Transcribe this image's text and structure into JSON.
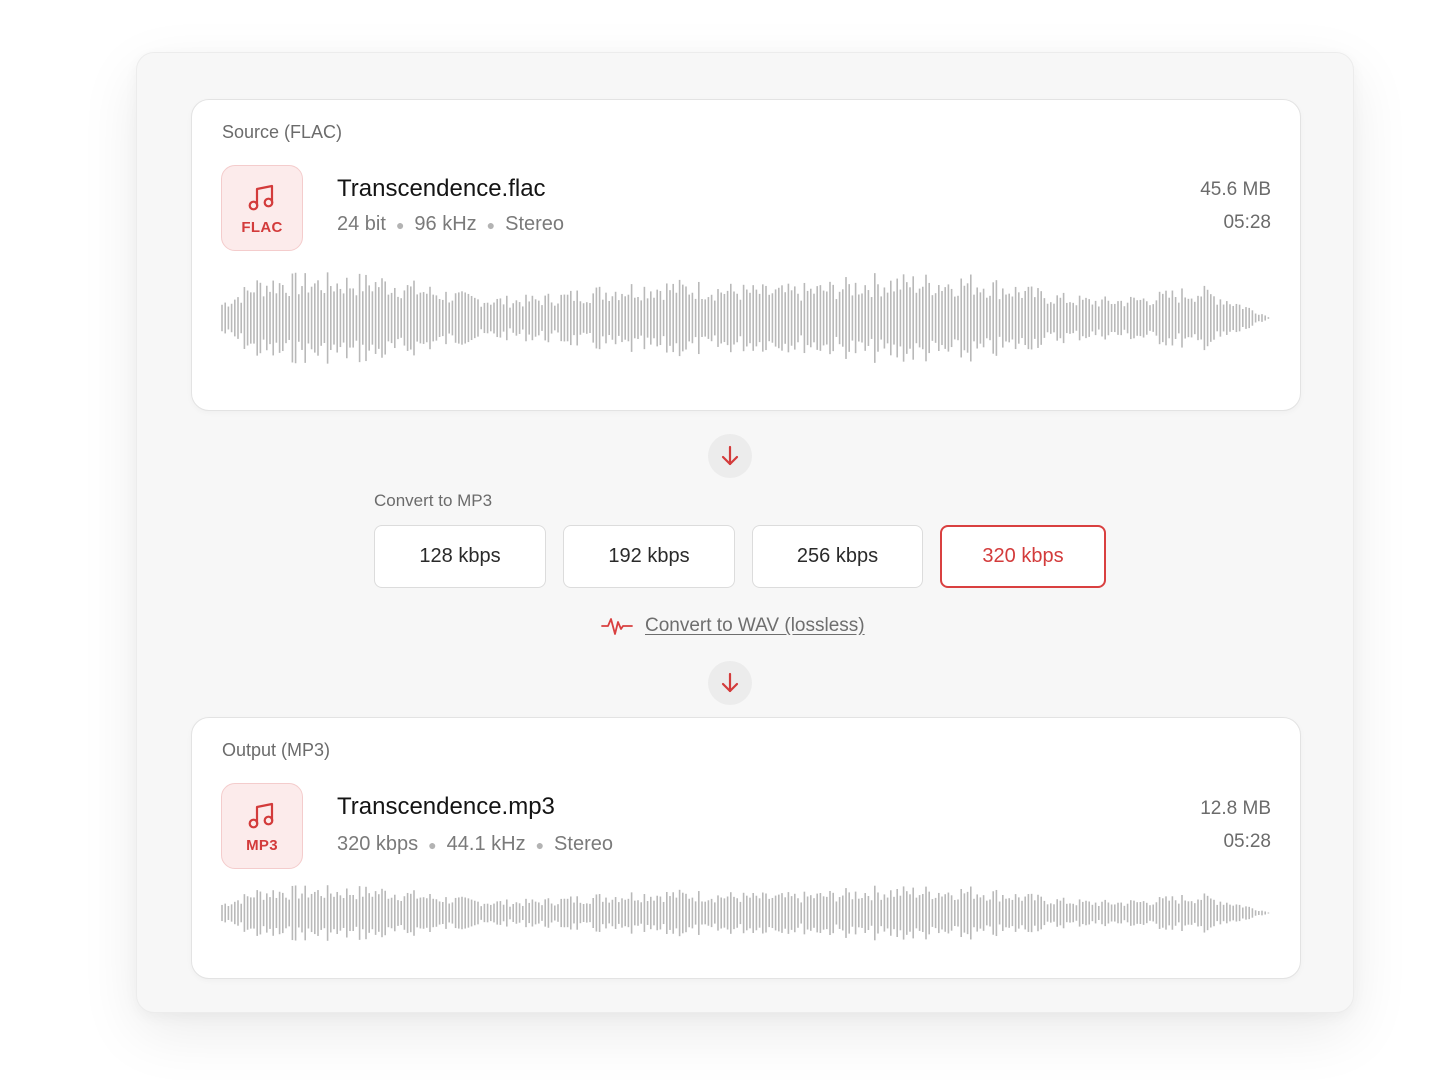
{
  "source": {
    "label": "Source (FLAC)",
    "format": "FLAC",
    "file_name": "Transcendence.flac",
    "meta": [
      "24 bit",
      "96 kHz",
      "Stereo"
    ],
    "size": "45.6 MB",
    "duration": "05:28"
  },
  "convert": {
    "label": "Convert to MP3",
    "options": [
      "128 kbps",
      "192 kbps",
      "256 kbps",
      "320 kbps"
    ],
    "selected": "320 kbps",
    "wav_link": "Convert to WAV (lossless)"
  },
  "output": {
    "label": "Output (MP3)",
    "format": "MP3",
    "file_name": "Transcendence.mp3",
    "meta": [
      "320 kbps",
      "44.1 kHz",
      "Stereo"
    ],
    "size": "12.8 MB",
    "duration": "05:28"
  },
  "colors": {
    "accent": "#d94040",
    "badge_bg": "#fcebeb",
    "waveform": "#b9b9b9"
  },
  "icons": {
    "format_badge": "music-note-icon",
    "arrow": "arrow-down-icon",
    "wav_link": "waveform-pulse-icon"
  }
}
